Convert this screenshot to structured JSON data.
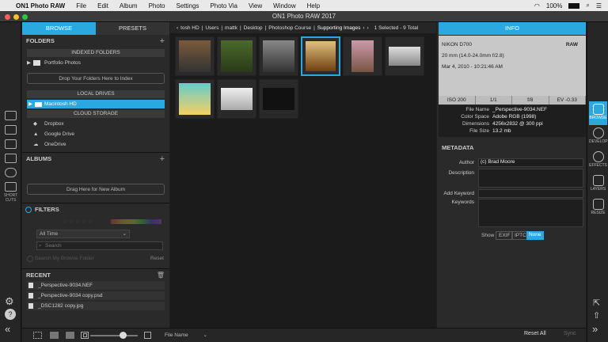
{
  "menubar": {
    "app": "ON1 Photo RAW",
    "items": [
      "File",
      "Edit",
      "Album",
      "Photo",
      "Settings",
      "Photo Via",
      "View",
      "Window",
      "Help"
    ],
    "battery": "100%",
    "time": ""
  },
  "window": {
    "title": "ON1 Photo RAW 2017"
  },
  "left_strip": {
    "shortcuts_label": "SHORT CUTS"
  },
  "left_panel": {
    "tabs": [
      "BROWSE",
      "PRESETS"
    ],
    "folders": {
      "title": "FOLDERS",
      "indexed_title": "INDEXED FOLDERS",
      "indexed_item": "Portfolio Photos",
      "drop_label": "Drop Your Folders Here to Index",
      "local_title": "LOCAL DRIVES",
      "local_item": "Macintosh HD",
      "cloud_title": "CLOUD STORAGE",
      "cloud_items": [
        "Dropbox",
        "Google Drive",
        "OneDrive"
      ]
    },
    "albums": {
      "title": "ALBUMS",
      "drag_label": "Drag Here for New Album"
    },
    "filters": {
      "title": "FILTERS",
      "date_value": "All Time",
      "search_placeholder": "Search",
      "reset_label": "Reset",
      "browse_label": "Search My Browse Folder"
    },
    "recent": {
      "title": "RECENT",
      "items": [
        "_Perspective-9034.NEF",
        "_Perspective-9034 copy.psd",
        "_DSC1282 copy.jpg"
      ]
    }
  },
  "pathbar": {
    "segments": [
      "tosh HD",
      "Users",
      "mattk",
      "Desktop",
      "Photoshop Course",
      "Supporting Images"
    ],
    "selection": "1 Selected - 9 Total"
  },
  "thumbnails": [
    {
      "name": "folder-sunset",
      "selected": false
    },
    {
      "name": "folder-green",
      "selected": false
    },
    {
      "name": "arch-building",
      "selected": false
    },
    {
      "name": "perspective-room",
      "selected": true
    },
    {
      "name": "woman-portrait",
      "selected": false
    },
    {
      "name": "billboard",
      "selected": false
    },
    {
      "name": "table-setting",
      "selected": false
    },
    {
      "name": "white-room",
      "selected": false
    },
    {
      "name": "dark-slide",
      "selected": false
    }
  ],
  "info": {
    "title": "INFO",
    "camera": "NIKON D700",
    "format": "RAW",
    "lens": "20 mm (14.0-24.0mm f/2.8)",
    "date": "Mar 4, 2010 - 10:21:46 AM",
    "stats": [
      "ISO 200",
      "1/1",
      "f/8",
      "EV -0.33"
    ],
    "file": [
      {
        "k": "File Name",
        "v": "_Perspective-9034.NEF"
      },
      {
        "k": "Color Space",
        "v": "Adobe RGB (1998)"
      },
      {
        "k": "Dimensions",
        "v": "4256x2832 @ 300 ppi"
      },
      {
        "k": "File Size",
        "v": "13.2 mb"
      }
    ]
  },
  "metadata": {
    "title": "METADATA",
    "author_label": "Author",
    "author_value": "(c) Brad Moore",
    "description_label": "Description",
    "addkw_label": "Add Keyword",
    "keywords_label": "Keywords",
    "show_label": "Show",
    "show_options": [
      "EXIF",
      "IPTC",
      "None"
    ]
  },
  "right_strip": {
    "modules": [
      "BROWSE",
      "DEVELOP",
      "EFFECTS",
      "LAYERS",
      "RESIZE"
    ]
  },
  "bottombar": {
    "sort_value": "File Name",
    "reset_all": "Reset All",
    "sync": "Sync"
  },
  "colors": {
    "accent": "#2aa8e0"
  }
}
